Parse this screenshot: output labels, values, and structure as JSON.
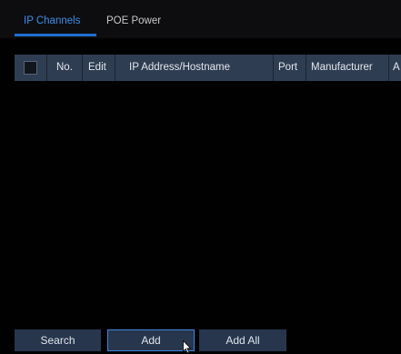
{
  "tabs": {
    "ip_channels": "IP Channels",
    "poe_power": "POE Power"
  },
  "table": {
    "columns": {
      "no": "No.",
      "edit": "Edit",
      "ip": "IP Address/Hostname",
      "port": "Port",
      "manufacturer": "Manufacturer",
      "extra": "A"
    },
    "rows": []
  },
  "buttons": {
    "search": "Search",
    "add": "Add",
    "add_all": "Add All"
  },
  "colors": {
    "active_tab": "#3a8fe6",
    "header_bg": "#2f3d52",
    "button_bg": "#27364d",
    "focus_border": "#3f86e0"
  },
  "icons": {
    "cursor": "mouse-pointer-icon"
  }
}
